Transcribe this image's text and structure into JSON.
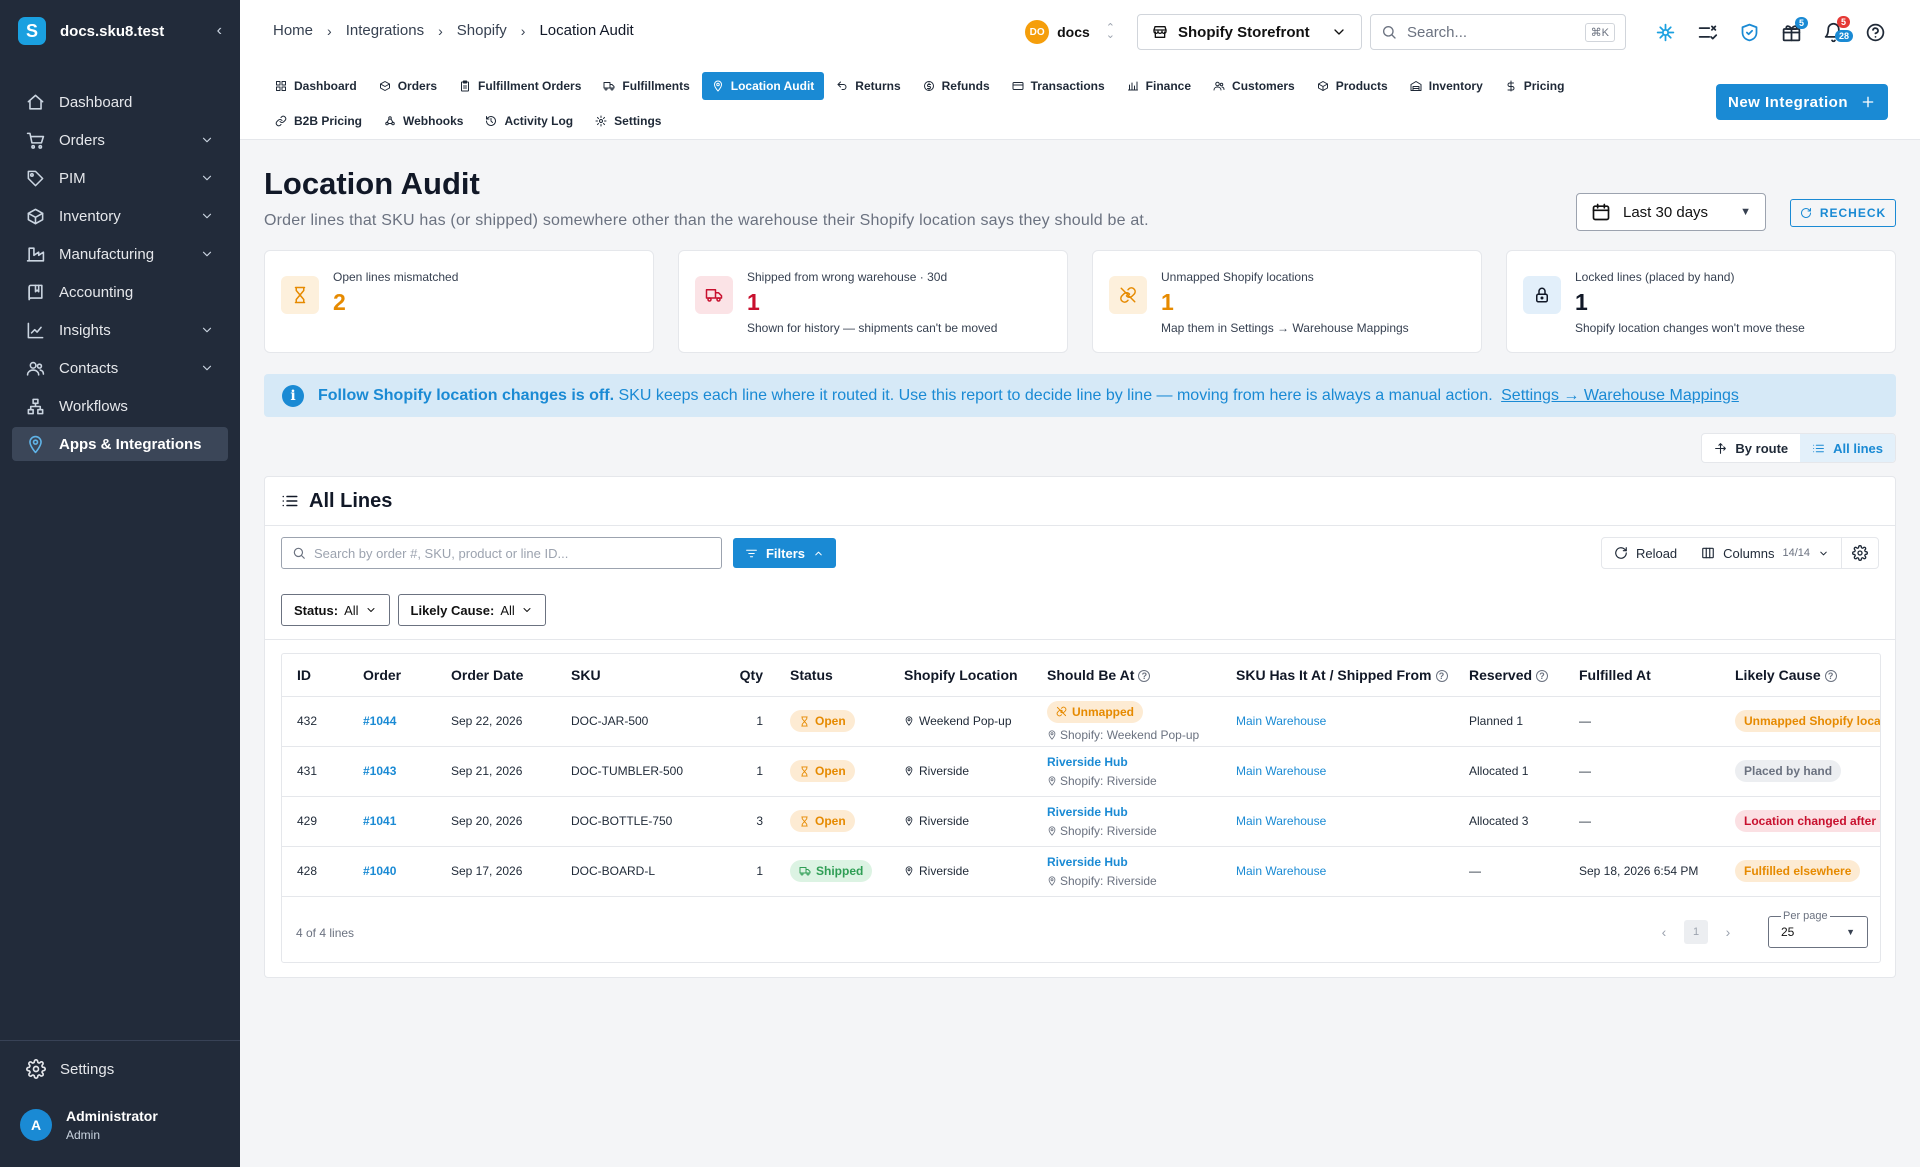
{
  "sidebar": {
    "workspace": "docs.sku8.test",
    "items": [
      {
        "label": "Dashboard",
        "icon": "home-icon",
        "chevron": false,
        "active": false
      },
      {
        "label": "Orders",
        "icon": "cart-icon",
        "chevron": true,
        "active": false
      },
      {
        "label": "PIM",
        "icon": "tag-icon",
        "chevron": true,
        "active": false
      },
      {
        "label": "Inventory",
        "icon": "box-icon",
        "chevron": true,
        "active": false
      },
      {
        "label": "Manufacturing",
        "icon": "factory-icon",
        "chevron": true,
        "active": false
      },
      {
        "label": "Accounting",
        "icon": "book-icon",
        "chevron": false,
        "active": false
      },
      {
        "label": "Insights",
        "icon": "chart-icon",
        "chevron": true,
        "active": false
      },
      {
        "label": "Contacts",
        "icon": "users-icon",
        "chevron": true,
        "active": false
      },
      {
        "label": "Workflows",
        "icon": "workflow-icon",
        "chevron": false,
        "active": false
      },
      {
        "label": "Apps & Integrations",
        "icon": "plug-icon",
        "chevron": false,
        "active": true
      }
    ],
    "settings_label": "Settings",
    "user": {
      "initial": "A",
      "name": "Administrator",
      "role": "Admin"
    }
  },
  "breadcrumb": [
    "Home",
    "Integrations",
    "Shopify",
    "Location Audit"
  ],
  "header": {
    "org_initials": "DO",
    "org_name": "docs",
    "store_name": "Shopify Storefront",
    "search_placeholder": "Search...",
    "search_shortcut": "⌘K",
    "gift_badge": "5",
    "notif_badge_red": "5",
    "notif_badge_blue": "28"
  },
  "tabs": [
    {
      "label": "Dashboard",
      "icon": "dashboard-icon",
      "active": false
    },
    {
      "label": "Orders",
      "icon": "package-icon",
      "active": false
    },
    {
      "label": "Fulfillment Orders",
      "icon": "clipboard-icon",
      "active": false
    },
    {
      "label": "Fulfillments",
      "icon": "truck-icon",
      "active": false
    },
    {
      "label": "Location Audit",
      "icon": "pin-icon",
      "active": true
    },
    {
      "label": "Returns",
      "icon": "return-icon",
      "active": false
    },
    {
      "label": "Refunds",
      "icon": "refund-icon",
      "active": false
    },
    {
      "label": "Transactions",
      "icon": "card-icon",
      "active": false
    },
    {
      "label": "Finance",
      "icon": "finance-icon",
      "active": false
    },
    {
      "label": "Customers",
      "icon": "users-icon",
      "active": false
    },
    {
      "label": "Products",
      "icon": "cube-icon",
      "active": false
    },
    {
      "label": "Inventory",
      "icon": "warehouse-icon",
      "active": false
    },
    {
      "label": "Pricing",
      "icon": "dollar-icon",
      "active": false
    },
    {
      "label": "B2B Pricing",
      "icon": "link-icon",
      "active": false
    },
    {
      "label": "Webhooks",
      "icon": "webhook-icon",
      "active": false
    },
    {
      "label": "Activity Log",
      "icon": "history-icon",
      "active": false
    },
    {
      "label": "Settings",
      "icon": "gear-icon",
      "active": false
    }
  ],
  "new_integration_label": "New Integration",
  "page": {
    "title": "Location Audit",
    "subtitle": "Order lines that SKU has (or shipped) somewhere other than the warehouse their Shopify location says they should be at.",
    "date_range": "Last 30 days",
    "recheck_label": "RECHECK"
  },
  "stats": [
    {
      "label": "Open lines mismatched",
      "value": "2",
      "note": "",
      "color": "#e68a00",
      "bg": "#fdf0dc",
      "icon": "hourglass-icon"
    },
    {
      "label": "Shipped from wrong warehouse · 30d",
      "value": "1",
      "note": "Shown for history — shipments can't be moved",
      "color": "#c8102e",
      "bg": "#fbe3e6",
      "icon": "truck-icon"
    },
    {
      "label": "Unmapped Shopify locations",
      "value": "1",
      "note": "Map them in Settings → Warehouse Mappings",
      "color": "#e68a00",
      "bg": "#fdf0dc",
      "icon": "unlink-icon"
    },
    {
      "label": "Locked lines (placed by hand)",
      "value": "1",
      "note": "Shopify location changes won't move these",
      "color": "#111827",
      "bg": "#e2effa",
      "icon": "lock-icon"
    }
  ],
  "banner": {
    "bold": "Follow Shopify location changes is off.",
    "text": "SKU keeps each line where it routed it. Use this report to decide line by line — moving from here is always a manual action.",
    "link": "Settings → Warehouse Mappings"
  },
  "view_toggle": {
    "by_route": "By route",
    "all_lines": "All lines"
  },
  "panel": {
    "title": "All Lines",
    "search_placeholder": "Search by order #, SKU, product or line ID...",
    "filters_label": "Filters",
    "reload_label": "Reload",
    "columns_label": "Columns",
    "columns_count": "14/14",
    "chips": [
      {
        "key": "Status:",
        "value": "All"
      },
      {
        "key": "Likely Cause:",
        "value": "All"
      }
    ]
  },
  "table": {
    "headers": [
      {
        "label": "ID",
        "help": false
      },
      {
        "label": "Order",
        "help": false
      },
      {
        "label": "Order Date",
        "help": false
      },
      {
        "label": "SKU",
        "help": false
      },
      {
        "label": "Qty",
        "help": false
      },
      {
        "label": "Status",
        "help": false
      },
      {
        "label": "Shopify Location",
        "help": false
      },
      {
        "label": "Should Be At",
        "help": true
      },
      {
        "label": "SKU Has It At / Shipped From",
        "help": true
      },
      {
        "label": "Reserved",
        "help": true
      },
      {
        "label": "Fulfilled At",
        "help": false
      },
      {
        "label": "Likely Cause",
        "help": true
      }
    ],
    "rows": [
      {
        "id": "432",
        "order": "#1044",
        "date": "Sep 22, 2026",
        "sku": "DOC-JAR-500",
        "qty": "1",
        "status": "Open",
        "status_kind": "open",
        "shopify_location": "Weekend Pop-up",
        "should_be": "Unmapped",
        "should_be_kind": "unmapped",
        "should_be_sub": "Shopify: Weekend Pop-up",
        "has_it_at": "Main Warehouse",
        "reserved": "Planned 1",
        "fulfilled_at": "—",
        "cause": "Unmapped Shopify location",
        "cause_kind": "unm"
      },
      {
        "id": "431",
        "order": "#1043",
        "date": "Sep 21, 2026",
        "sku": "DOC-TUMBLER-500",
        "qty": "1",
        "status": "Open",
        "status_kind": "open",
        "shopify_location": "Riverside",
        "should_be": "Riverside Hub",
        "should_be_kind": "link",
        "should_be_sub": "Shopify: Riverside",
        "has_it_at": "Main Warehouse",
        "reserved": "Allocated 1",
        "fulfilled_at": "—",
        "cause": "Placed by hand",
        "cause_kind": "hand"
      },
      {
        "id": "429",
        "order": "#1041",
        "date": "Sep 20, 2026",
        "sku": "DOC-BOTTLE-750",
        "qty": "3",
        "status": "Open",
        "status_kind": "open",
        "shopify_location": "Riverside",
        "should_be": "Riverside Hub",
        "should_be_kind": "link",
        "should_be_sub": "Shopify: Riverside",
        "has_it_at": "Main Warehouse",
        "reserved": "Allocated 3",
        "fulfilled_at": "—",
        "cause": "Location changed after routing",
        "cause_kind": "chg"
      },
      {
        "id": "428",
        "order": "#1040",
        "date": "Sep 17, 2026",
        "sku": "DOC-BOARD-L",
        "qty": "1",
        "status": "Shipped",
        "status_kind": "ship",
        "shopify_location": "Riverside",
        "should_be": "Riverside Hub",
        "should_be_kind": "link",
        "should_be_sub": "Shopify: Riverside",
        "has_it_at": "Main Warehouse",
        "reserved": "—",
        "fulfilled_at": "Sep 18, 2026 6:54 PM",
        "cause": "Fulfilled elsewhere",
        "cause_kind": "ful"
      }
    ],
    "footer_count": "4 of 4 lines",
    "page": "1",
    "per_page_label": "Per page",
    "per_page": "25"
  }
}
